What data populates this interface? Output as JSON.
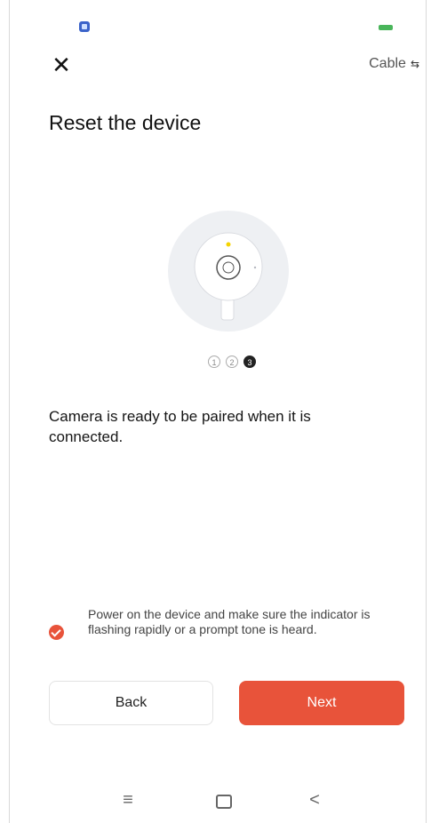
{
  "header": {
    "close_icon": "close-icon",
    "cable_label": "Cable",
    "cable_icon": "cable-icon"
  },
  "page": {
    "title": "Reset the device"
  },
  "steps": {
    "labels": [
      "1",
      "2",
      "3"
    ],
    "active_index": 2
  },
  "instruction": {
    "text": "Camera is ready to be paired when it is connected."
  },
  "confirm": {
    "checked": true,
    "text": "Power on the device and make sure the indicator is flashing rapidly or a prompt tone is heard."
  },
  "buttons": {
    "back_label": "Back",
    "next_label": "Next"
  },
  "system_nav": {
    "recents_glyph": "≡",
    "home_icon": "home-icon",
    "back_glyph": "<"
  },
  "colors": {
    "accent": "#e8533a",
    "indicator_led": "#f5d400"
  }
}
